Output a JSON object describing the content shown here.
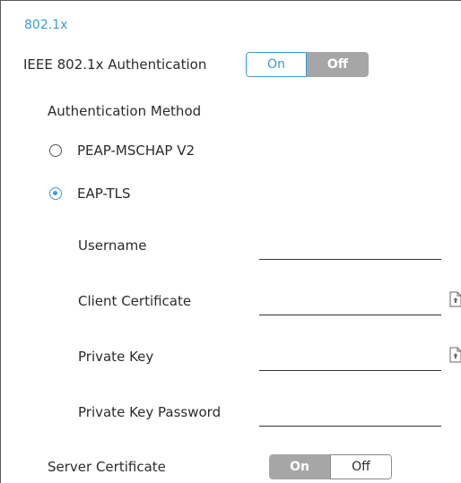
{
  "section": {
    "title": "802.1x"
  },
  "ieee_auth": {
    "label": "IEEE 802.1x Authentication",
    "on_label": "On",
    "off_label": "Off",
    "selected": "On"
  },
  "auth_method": {
    "label": "Authentication Method",
    "options": [
      {
        "label": "PEAP-MSCHAP V2",
        "selected": false
      },
      {
        "label": "EAP-TLS",
        "selected": true
      }
    ]
  },
  "fields": {
    "username": {
      "label": "Username",
      "value": ""
    },
    "client_certificate": {
      "label": "Client Certificate",
      "value": ""
    },
    "private_key": {
      "label": "Private Key",
      "value": ""
    },
    "private_key_password": {
      "label": "Private Key Password",
      "value": ""
    }
  },
  "server_certificate": {
    "label": "Server Certificate",
    "on_label": "On",
    "off_label": "Off",
    "selected": "Off"
  },
  "icons": {
    "upload": "upload-file-icon"
  },
  "colors": {
    "accent": "#3a9ad9",
    "inactive": "#a6a6a6",
    "text": "#2b2b2b"
  }
}
